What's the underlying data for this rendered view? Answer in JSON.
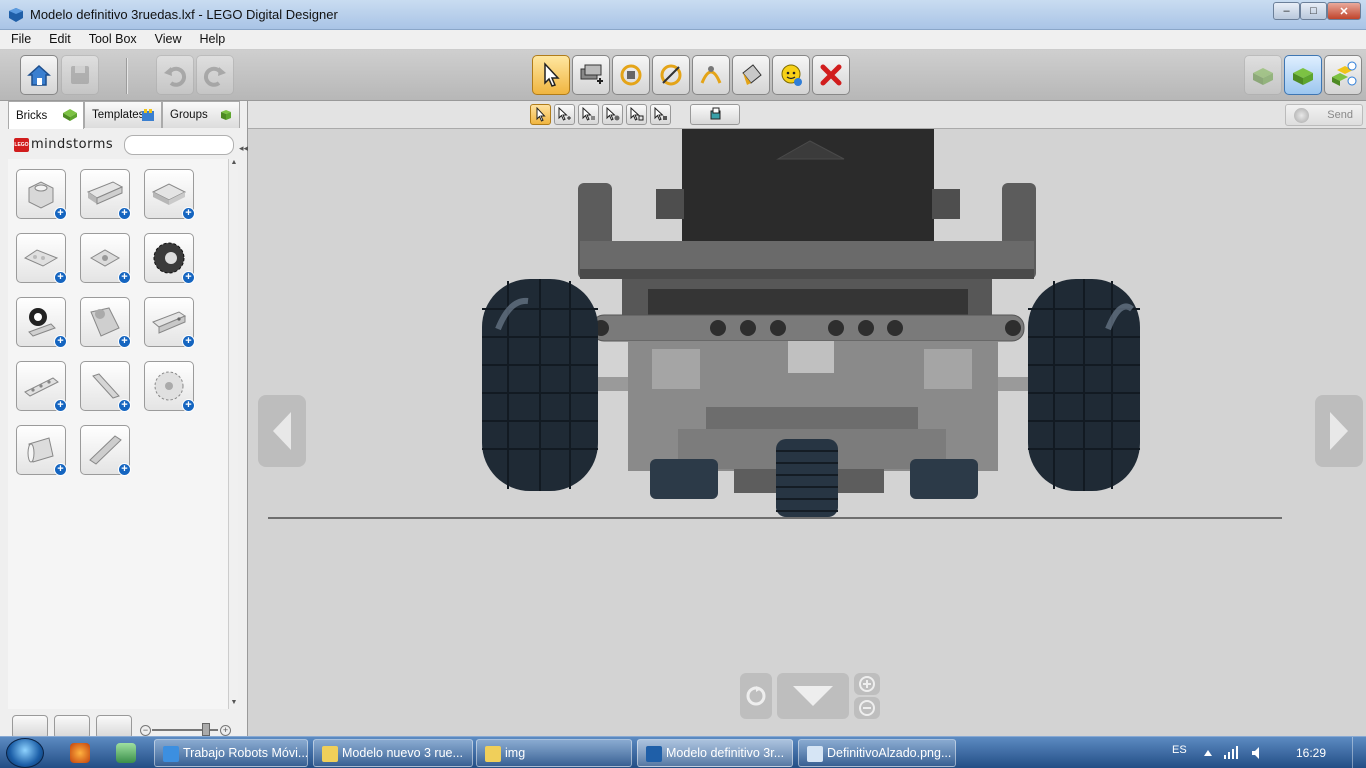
{
  "window": {
    "title": "Modelo definitivo 3ruedas.lxf - LEGO Digital Designer",
    "min_glyph": "–",
    "max_glyph": "□",
    "close_glyph": "✕"
  },
  "menu": [
    "File",
    "Edit",
    "Tool Box",
    "View",
    "Help"
  ],
  "toolbar": {
    "left_buttons": [
      "home",
      "save",
      "undo",
      "redo"
    ],
    "tools": [
      "select",
      "clone",
      "hinge",
      "hinge-align",
      "flex",
      "paint",
      "hide",
      "delete"
    ],
    "right_buttons": [
      "build-mode",
      "view-mode",
      "building-guide"
    ]
  },
  "select_modes": [
    "single",
    "multiple",
    "connected",
    "same-color",
    "same-brick",
    "same-color-brick"
  ],
  "send_button": "Send",
  "panel": {
    "tabs": [
      "Bricks",
      "Templates",
      "Groups"
    ],
    "active_tab": "Bricks",
    "brand": "mindstorms",
    "logo_text": "LEGO",
    "search_value": "",
    "collapse_glyph": "◂◂",
    "bricks": [
      "round-brick",
      "technic-beam",
      "plate-2x2",
      "angle-plate",
      "connector-plate",
      "gear-wheel",
      "sensor",
      "motor",
      "technic-brick",
      "liftarm",
      "axle-pin",
      "gear",
      "pipe",
      "flex-axle"
    ]
  },
  "colors": {
    "titlebar": "#a9c4e6",
    "toolbar": "#c4c4c4",
    "viewport_bg": "#d3d3d3",
    "active_tool": "#f0b540",
    "taskbar": "#234e85"
  },
  "taskbar": {
    "items": [
      {
        "label": "Trabajo Robots Móvi...",
        "icon": "ie-icon"
      },
      {
        "label": "Modelo nuevo 3 rue...",
        "icon": "folder-icon"
      },
      {
        "label": "img",
        "icon": "folder-icon"
      },
      {
        "label": "Modelo definitivo 3r...",
        "icon": "lego-icon",
        "active": true
      },
      {
        "label": "DefinitivoAlzado.png...",
        "icon": "paint-icon"
      }
    ],
    "lang": "ES",
    "time": "16:29"
  }
}
